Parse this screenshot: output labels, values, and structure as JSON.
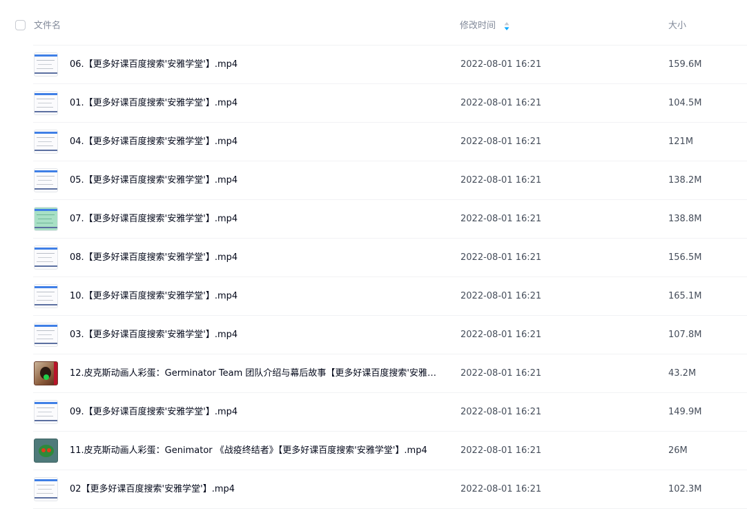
{
  "header": {
    "name_label": "文件名",
    "time_label": "修改时间",
    "size_label": "大小",
    "sort_color": "#06a7ff"
  },
  "files": [
    {
      "name": "06.【更多好课百度搜索'安雅学堂'】.mp4",
      "modified": "2022-08-01 16:21",
      "size": "159.6M",
      "thumb": "video-thumbnail"
    },
    {
      "name": "01.【更多好课百度搜索'安雅学堂'】.mp4",
      "modified": "2022-08-01 16:21",
      "size": "104.5M",
      "thumb": "video-thumbnail"
    },
    {
      "name": "04.【更多好课百度搜索'安雅学堂'】.mp4",
      "modified": "2022-08-01 16:21",
      "size": "121M",
      "thumb": "video-thumbnail"
    },
    {
      "name": "05.【更多好课百度搜索'安雅学堂'】.mp4",
      "modified": "2022-08-01 16:21",
      "size": "138.2M",
      "thumb": "video-thumbnail"
    },
    {
      "name": "07.【更多好课百度搜索'安雅学堂'】.mp4",
      "modified": "2022-08-01 16:21",
      "size": "138.8M",
      "thumb": "video-thumbnail-green"
    },
    {
      "name": "08.【更多好课百度搜索'安雅学堂'】.mp4",
      "modified": "2022-08-01 16:21",
      "size": "156.5M",
      "thumb": "video-thumbnail"
    },
    {
      "name": "10.【更多好课百度搜索'安雅学堂'】.mp4",
      "modified": "2022-08-01 16:21",
      "size": "165.1M",
      "thumb": "video-thumbnail"
    },
    {
      "name": "03.【更多好课百度搜索'安雅学堂'】.mp4",
      "modified": "2022-08-01 16:21",
      "size": "107.8M",
      "thumb": "video-thumbnail"
    },
    {
      "name": "12.皮克斯动画人彩蛋：Germinator Team 团队介绍与幕后故事【更多好课百度搜索'安雅学...",
      "modified": "2022-08-01 16:21",
      "size": "43.2M",
      "thumb": "person-thumbnail"
    },
    {
      "name": "09.【更多好课百度搜索'安雅学堂'】.mp4",
      "modified": "2022-08-01 16:21",
      "size": "149.9M",
      "thumb": "video-thumbnail"
    },
    {
      "name": "11.皮克斯动画人彩蛋：Genimator 《战疫终结者》【更多好课百度搜索'安雅学堂'】.mp4",
      "modified": "2022-08-01 16:21",
      "size": "26M",
      "thumb": "monster-thumbnail"
    },
    {
      "name": "02【更多好课百度搜索'安雅学堂'】.mp4",
      "modified": "2022-08-01 16:21",
      "size": "102.3M",
      "thumb": "video-thumbnail"
    }
  ]
}
